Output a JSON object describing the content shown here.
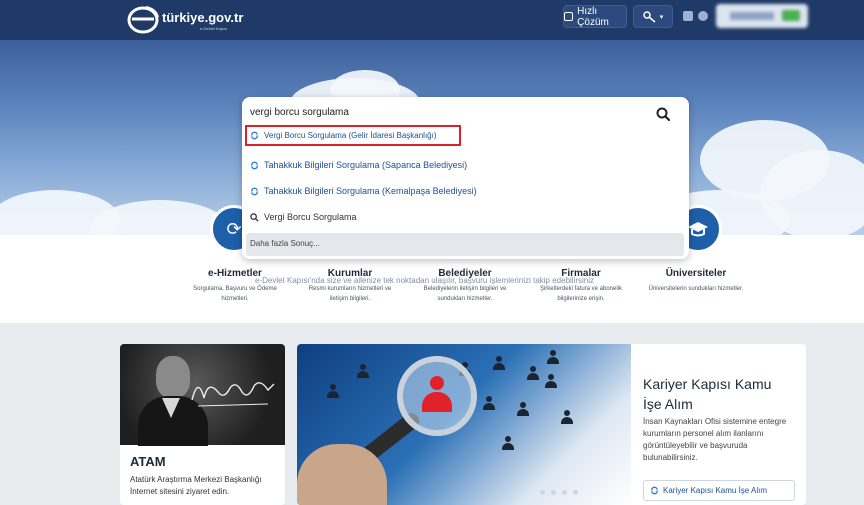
{
  "header": {
    "logo_text": "türkiye.gov.tr",
    "logo_sub": "e-Devlet Kapısı",
    "quick_solution": "Hızlı Çözüm",
    "user_badge": "blurred"
  },
  "search": {
    "query": "vergi borcu sorgulama",
    "results": [
      {
        "label": "Vergi Borcu Sorgulama (Gelir İdaresi Başkanlığı)",
        "icon": "refresh-icon",
        "highlighted": true
      },
      {
        "label": "Tahakkuk Bilgileri Sorgulama (Sapanca Belediyesi)",
        "icon": "refresh-icon"
      },
      {
        "label": "Tahakkuk Bilgileri Sorgulama (Kemalpaşa Belediyesi)",
        "icon": "refresh-icon"
      },
      {
        "label": "Vergi Borcu Sorgulama",
        "icon": "search-icon"
      }
    ],
    "more": "Daha fazla Sonuç..."
  },
  "categories": [
    {
      "title": "e-Hizmetler",
      "desc": "Sorgulama, Başvuru ve Ödeme hizmetleri."
    },
    {
      "title": "Kurumlar",
      "desc": "Resmi kurumların hizmetleri ve iletişim bilgileri."
    },
    {
      "title": "Belediyeler",
      "desc": "Belediyelerin iletişim bilgileri ve sundukları hizmetler."
    },
    {
      "title": "Firmalar",
      "desc": "Şirketlerdeki fatura ve abonelik bilgilerinize erişin."
    },
    {
      "title": "Üniversiteler",
      "desc": "Üniversitelerin sundukları hizmetler."
    }
  ],
  "ticker": "e-Devlet Kapısı'nda size ve ailenize tek noktadan ulaşılır, başvuru işlemlerinizi takip edebilirsiniz",
  "cards": {
    "atam": {
      "title": "ATAM",
      "desc": "Atatürk Araştırma Merkezi Başkanlığı İnternet sitesini ziyaret edin."
    },
    "kariyer": {
      "title": "Kariyer Kapısı Kamu İşe Alım",
      "desc": "İnsan Kaynakları Ofisi sistemine entegre kurumların personel alım ilanlarını görüntüleyebilir ve başvuruda bulunabilirsiniz.",
      "button": "Kariyer Kapısı Kamu İşe Alım"
    }
  },
  "colors": {
    "header": "#1f3a66",
    "accent": "#1d5fa8",
    "highlight": "#d8222a"
  }
}
